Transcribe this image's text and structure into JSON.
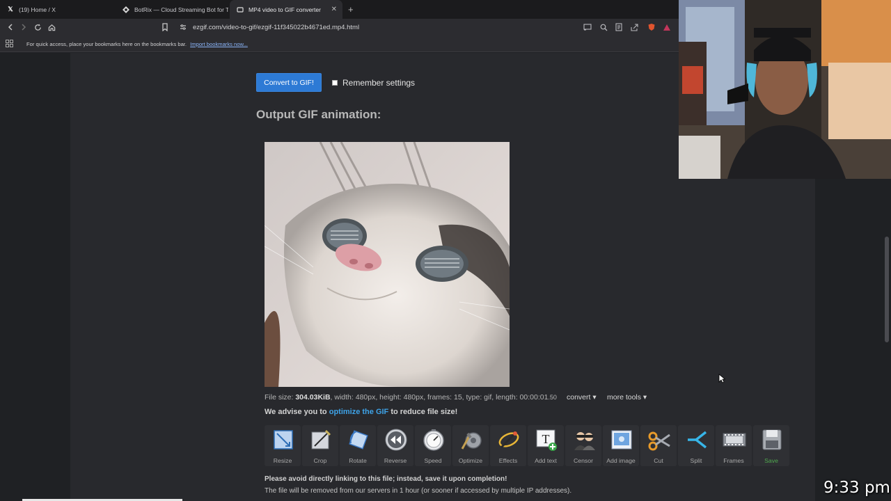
{
  "tabs": [
    {
      "title": "(19) Home / X",
      "icon": "x-logo-icon"
    },
    {
      "title": "BotRix — Cloud Streaming Bot for Tw",
      "icon": "botrix-icon"
    },
    {
      "title": "MP4 video to GIF converter",
      "icon": "ezgif-icon",
      "active": true
    }
  ],
  "address": {
    "url": "ezgif.com/video-to-gif/ezgif-11f345022b4671ed.mp4.html"
  },
  "bookmarks_bar": {
    "message": "For quick access, place your bookmarks here on the bookmarks bar.",
    "link": "Import bookmarks now..."
  },
  "form": {
    "convert_button": "Convert to GIF!",
    "remember_label": "Remember settings",
    "remember_checked": false
  },
  "output": {
    "title": "Output GIF animation:",
    "image_alt": "cat-gif-image"
  },
  "file_info": {
    "label": "File size: ",
    "size": "304.03KiB",
    "details": ", width: 480px, height: 480px, frames: 15, type: gif, length: 00:00:01",
    "decimals": ".50",
    "convert_menu": "convert ▾",
    "more_tools_menu": "more tools ▾"
  },
  "advice": {
    "prefix": "We advise you to ",
    "link": "optimize the GIF",
    "suffix": " to reduce file size!"
  },
  "tools": [
    {
      "label": "Resize",
      "icon": "resize-icon"
    },
    {
      "label": "Crop",
      "icon": "crop-icon"
    },
    {
      "label": "Rotate",
      "icon": "rotate-icon"
    },
    {
      "label": "Reverse",
      "icon": "reverse-icon"
    },
    {
      "label": "Speed",
      "icon": "speed-icon"
    },
    {
      "label": "Optimize",
      "icon": "optimize-icon"
    },
    {
      "label": "Effects",
      "icon": "effects-icon"
    },
    {
      "label": "Add text",
      "icon": "add-text-icon"
    },
    {
      "label": "Censor",
      "icon": "censor-icon"
    },
    {
      "label": "Add image",
      "icon": "add-image-icon"
    },
    {
      "label": "Cut",
      "icon": "cut-icon"
    },
    {
      "label": "Split",
      "icon": "split-icon"
    },
    {
      "label": "Frames",
      "icon": "frames-icon"
    },
    {
      "label": "Save",
      "icon": "save-icon"
    }
  ],
  "notices": {
    "line1": "Please avoid directly linking to this file; instead, save it upon completion!",
    "line2": "The file will be removed from our servers in 1 hour (or sooner if accessed by multiple IP addresses)."
  },
  "overlay": {
    "clock": "9:33 pm"
  },
  "colors": {
    "accent": "#2d7ad5",
    "link": "#3ea3e8",
    "save": "#4fa84f"
  }
}
